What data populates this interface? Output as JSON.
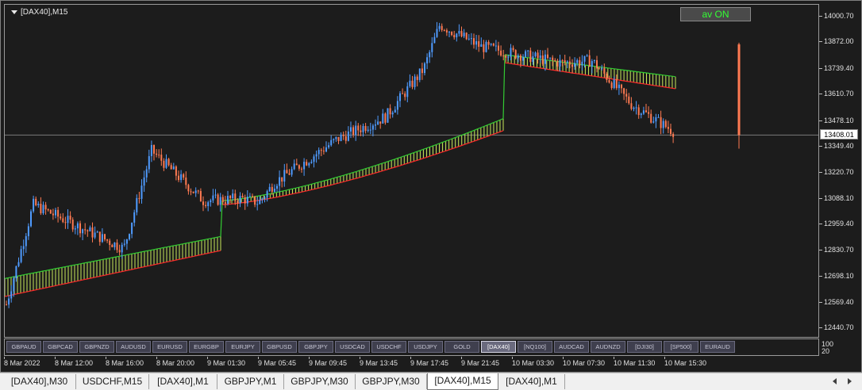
{
  "chart": {
    "title": "[DAX40],M15",
    "av_button": "av ON",
    "current_price": "13408.01",
    "current_price_value": 13408.01,
    "y_range": [
      12390,
      14060
    ],
    "bg_color": "#1c1c1c",
    "bull_color": "#4f9bff",
    "bear_color": "#ff7a52",
    "cloud_up_color": "#c8e85a",
    "cloud_top_color": "#33cc33",
    "cloud_bottom_color": "#ff2a2a",
    "price_ticks": [
      "14000.70",
      "13872.00",
      "13739.40",
      "13610.70",
      "13478.10",
      "13349.40",
      "13220.70",
      "13088.10",
      "12959.40",
      "12830.70",
      "12698.10",
      "12569.40",
      "12440.70"
    ]
  },
  "symbols": [
    {
      "label": "GBPAUD",
      "active": false
    },
    {
      "label": "GBPCAD",
      "active": false
    },
    {
      "label": "GBPNZD",
      "active": false
    },
    {
      "label": "AUDUSD",
      "active": false
    },
    {
      "label": "EURUSD",
      "active": false
    },
    {
      "label": "EURGBP",
      "active": false
    },
    {
      "label": "EURJPY",
      "active": false
    },
    {
      "label": "GBPUSD",
      "active": false
    },
    {
      "label": "GBPJPY",
      "active": false
    },
    {
      "label": "USDCAD",
      "active": false
    },
    {
      "label": "USDCHF",
      "active": false
    },
    {
      "label": "USDJPY",
      "active": false
    },
    {
      "label": "GOLD",
      "active": false
    },
    {
      "label": "[DAX40]",
      "active": true
    },
    {
      "label": "[NQ100]",
      "active": false
    },
    {
      "label": "AUDCAD",
      "active": false
    },
    {
      "label": "AUDNZD",
      "active": false
    },
    {
      "label": "[DJI30]",
      "active": false
    },
    {
      "label": "[SP500]",
      "active": false
    },
    {
      "label": "EURAUD",
      "active": false
    }
  ],
  "sub_axis": {
    "top": "100",
    "bottom": "20"
  },
  "time_labels": [
    "8 Mar 2022",
    "8 Mar 12:00",
    "8 Mar 16:00",
    "8 Mar 20:00",
    "9 Mar 01:30",
    "9 Mar 05:45",
    "9 Mar 09:45",
    "9 Mar 13:45",
    "9 Mar 17:45",
    "9 Mar 21:45",
    "10 Mar 03:30",
    "10 Mar 07:30",
    "10 Mar 11:30",
    "10 Mar 15:30"
  ],
  "tabs": [
    {
      "label": "[DAX40],M30",
      "active": false
    },
    {
      "label": "USDCHF,M15",
      "active": false
    },
    {
      "label": "[DAX40],M1",
      "active": false
    },
    {
      "label": "GBPJPY,M1",
      "active": false
    },
    {
      "label": "GBPJPY,M30",
      "active": false
    },
    {
      "label": "GBPJPY,M30",
      "active": false
    },
    {
      "label": "[DAX40],M15",
      "active": true
    },
    {
      "label": "[DAX40],M1",
      "active": false
    }
  ],
  "chart_data": {
    "type": "candlestick",
    "symbol": "[DAX40]",
    "timeframe": "M15",
    "close_path": [
      [
        "8 Mar 2022",
        12560
      ],
      [
        "8 Mar 12:00",
        13060
      ],
      [
        "8 Mar 16:00",
        12840
      ],
      [
        "8 Mar 16:00",
        13330
      ],
      [
        "8 Mar 20:00",
        13080
      ],
      [
        "9 Mar 01:30",
        13090
      ],
      [
        "9 Mar 05:45",
        13070
      ],
      [
        "9 Mar 05:45",
        13170
      ],
      [
        "9 Mar 09:45",
        13390
      ],
      [
        "9 Mar 13:45",
        13500
      ],
      [
        "9 Mar 17:45",
        13740
      ],
      [
        "9 Mar 17:45",
        13960
      ],
      [
        "9 Mar 21:45",
        13850
      ],
      [
        "10 Mar 03:30",
        13770
      ],
      [
        "10 Mar 07:30",
        13780
      ],
      [
        "10 Mar 11:30",
        13560
      ],
      [
        "10 Mar 15:30",
        13420
      ]
    ],
    "cloud_segments": [
      {
        "from": "8 Mar 2022",
        "to": "9 Mar 01:30",
        "top_range": [
          12690,
          12900
        ],
        "bottom_range": [
          12600,
          12830
        ]
      },
      {
        "from": "9 Mar 01:30",
        "to": "9 Mar 21:45",
        "top_range": [
          13080,
          13490
        ],
        "bottom_range": [
          13060,
          13430
        ]
      },
      {
        "from": "9 Mar 21:45",
        "to": "10 Mar 15:30",
        "top_range": [
          13810,
          13700
        ],
        "bottom_range": [
          13770,
          13640
        ]
      }
    ],
    "last_bar": {
      "label": "current candle",
      "high": 13870,
      "low": 13340
    },
    "ylim": [
      12390,
      14060
    ]
  }
}
